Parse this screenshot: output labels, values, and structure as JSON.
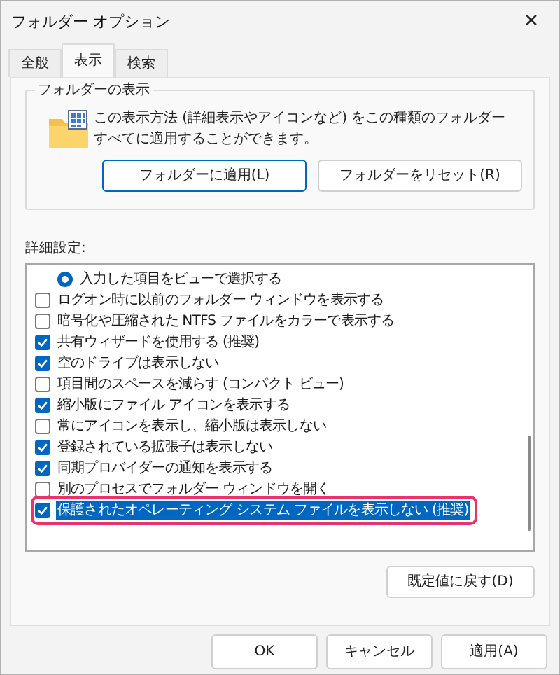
{
  "window": {
    "title": "フォルダー オプション",
    "close": "✕"
  },
  "tabs": [
    {
      "label": "全般",
      "selected": false
    },
    {
      "label": "表示",
      "selected": true
    },
    {
      "label": "検索",
      "selected": false
    }
  ],
  "folder_views": {
    "legend": "フォルダーの表示",
    "description": "この表示方法 (詳細表示やアイコンなど) をこの種類のフォルダーすべてに適用することができます。",
    "buttons": [
      "フォルダーに適用(L)",
      "フォルダーをリセット(R)"
    ]
  },
  "advanced": {
    "label": "詳細設定:",
    "items": [
      {
        "kind": "radio",
        "label": "入力した項目をビューで選択する",
        "checked": true,
        "selected": false,
        "marked": false
      },
      {
        "kind": "checkbox",
        "label": "ログオン時に以前のフォルダー ウィンドウを表示する",
        "checked": false,
        "selected": false,
        "marked": false
      },
      {
        "kind": "checkbox",
        "label": "暗号化や圧縮された NTFS ファイルをカラーで表示する",
        "checked": false,
        "selected": false,
        "marked": false
      },
      {
        "kind": "checkbox",
        "label": "共有ウィザードを使用する (推奨)",
        "checked": true,
        "selected": false,
        "marked": false
      },
      {
        "kind": "checkbox",
        "label": "空のドライブは表示しない",
        "checked": true,
        "selected": false,
        "marked": false
      },
      {
        "kind": "checkbox",
        "label": "項目間のスペースを減らす (コンパクト ビュー)",
        "checked": false,
        "selected": false,
        "marked": false
      },
      {
        "kind": "checkbox",
        "label": "縮小版にファイル アイコンを表示する",
        "checked": true,
        "selected": false,
        "marked": false
      },
      {
        "kind": "checkbox",
        "label": "常にアイコンを表示し、縮小版は表示しない",
        "checked": false,
        "selected": false,
        "marked": false
      },
      {
        "kind": "checkbox",
        "label": "登録されている拡張子は表示しない",
        "checked": true,
        "selected": false,
        "marked": false
      },
      {
        "kind": "checkbox",
        "label": "同期プロバイダーの通知を表示する",
        "checked": true,
        "selected": false,
        "marked": false
      },
      {
        "kind": "checkbox",
        "label": "別のプロセスでフォルダー ウィンドウを開く",
        "checked": false,
        "selected": false,
        "marked": false
      },
      {
        "kind": "checkbox",
        "label": "保護されたオペレーティング システム ファイルを表示しない (推奨)",
        "checked": true,
        "selected": true,
        "marked": true
      }
    ],
    "restore_button": "既定値に戻す(D)"
  },
  "footer_buttons": [
    {
      "label": "OK",
      "default": false
    },
    {
      "label": "キャンセル",
      "default": false
    },
    {
      "label": "適用(A)",
      "default": false
    }
  ]
}
